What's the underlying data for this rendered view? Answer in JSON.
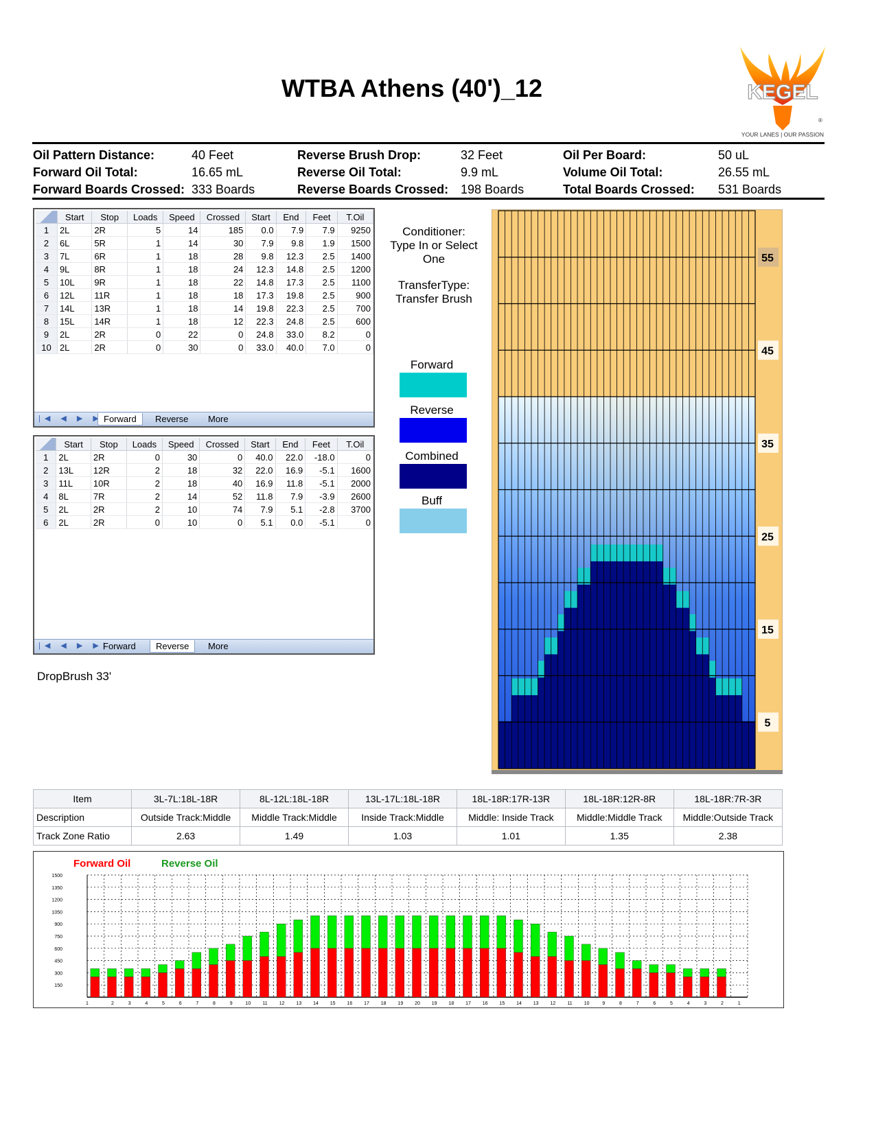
{
  "title": "WTBA Athens (40')_12",
  "logo": {
    "wordmark": "KEGEL",
    "tagline": "YOUR LANES | OUR PASSION",
    "trademark": "®"
  },
  "stats": [
    {
      "label": "Oil Pattern Distance:",
      "value": "40 Feet",
      "bold": true
    },
    {
      "label": "Forward Oil Total:",
      "value": "16.65 mL",
      "bold": false
    },
    {
      "label": "Forward Boards Crossed:",
      "value": "333 Boards",
      "bold": false
    },
    {
      "label": "Reverse Brush Drop:",
      "value": "32 Feet",
      "bold": false
    },
    {
      "label": "Reverse Oil Total:",
      "value": "9.9 mL",
      "bold": false
    },
    {
      "label": "Reverse Boards Crossed:",
      "value": "198 Boards",
      "bold": false
    },
    {
      "label": "Oil Per Board:",
      "value": "50 uL",
      "bold": true
    },
    {
      "label": "Volume Oil Total:",
      "value": "26.55 mL",
      "bold": false
    },
    {
      "label": "Total Boards Crossed:",
      "value": "531 Boards",
      "bold": false
    }
  ],
  "grid_headers": [
    "",
    "Start",
    "Stop",
    "Loads",
    "Speed",
    "Crossed",
    "Start",
    "End",
    "Feet",
    "T.Oil"
  ],
  "forward_rows": [
    [
      "1",
      "2L",
      "2R",
      "5",
      "14",
      "185",
      "0.0",
      "7.9",
      "7.9",
      "9250"
    ],
    [
      "2",
      "6L",
      "5R",
      "1",
      "14",
      "30",
      "7.9",
      "9.8",
      "1.9",
      "1500"
    ],
    [
      "3",
      "7L",
      "6R",
      "1",
      "18",
      "28",
      "9.8",
      "12.3",
      "2.5",
      "1400"
    ],
    [
      "4",
      "9L",
      "8R",
      "1",
      "18",
      "24",
      "12.3",
      "14.8",
      "2.5",
      "1200"
    ],
    [
      "5",
      "10L",
      "9R",
      "1",
      "18",
      "22",
      "14.8",
      "17.3",
      "2.5",
      "1100"
    ],
    [
      "6",
      "12L",
      "11R",
      "1",
      "18",
      "18",
      "17.3",
      "19.8",
      "2.5",
      "900"
    ],
    [
      "7",
      "14L",
      "13R",
      "1",
      "18",
      "14",
      "19.8",
      "22.3",
      "2.5",
      "700"
    ],
    [
      "8",
      "15L",
      "14R",
      "1",
      "18",
      "12",
      "22.3",
      "24.8",
      "2.5",
      "600"
    ],
    [
      "9",
      "2L",
      "2R",
      "0",
      "22",
      "0",
      "24.8",
      "33.0",
      "8.2",
      "0"
    ],
    [
      "10",
      "2L",
      "2R",
      "0",
      "30",
      "0",
      "33.0",
      "40.0",
      "7.0",
      "0"
    ]
  ],
  "reverse_rows": [
    [
      "1",
      "2L",
      "2R",
      "0",
      "30",
      "0",
      "40.0",
      "22.0",
      "-18.0",
      "0"
    ],
    [
      "2",
      "13L",
      "12R",
      "2",
      "18",
      "32",
      "22.0",
      "16.9",
      "-5.1",
      "1600"
    ],
    [
      "3",
      "11L",
      "10R",
      "2",
      "18",
      "40",
      "16.9",
      "11.8",
      "-5.1",
      "2000"
    ],
    [
      "4",
      "8L",
      "7R",
      "2",
      "14",
      "52",
      "11.8",
      "7.9",
      "-3.9",
      "2600"
    ],
    [
      "5",
      "2L",
      "2R",
      "2",
      "10",
      "74",
      "7.9",
      "5.1",
      "-2.8",
      "3700"
    ],
    [
      "6",
      "2L",
      "2R",
      "0",
      "10",
      "0",
      "5.1",
      "0.0",
      "-5.1",
      "0"
    ]
  ],
  "tabs": [
    "Forward",
    "Reverse",
    "More"
  ],
  "nav_glyphs": "|◀ ◀ ▶ ▶|",
  "drop_brush": "DropBrush 33'",
  "conditioner": [
    "Conditioner:",
    "Type In or Select",
    "One"
  ],
  "transfer": [
    "TransferType:",
    "Transfer Brush"
  ],
  "legend": [
    {
      "label": "Forward",
      "color": "#00cccc"
    },
    {
      "label": "Reverse",
      "color": "#0000ee"
    },
    {
      "label": "Combined",
      "color": "#000088"
    },
    {
      "label": "Buff",
      "color": "#87ceeb"
    }
  ],
  "colors": {
    "lane_wood": "#f9cc7a",
    "stat_green": "#1aa64b",
    "forward_oil": "#ff0000",
    "reverse_oil": "#00dd00",
    "title_red": "#ff0000"
  },
  "lane_scale": [
    "55",
    "45",
    "35",
    "25",
    "15",
    "5"
  ],
  "zone": {
    "headers": [
      "Item",
      "3L-7L:18L-18R",
      "8L-12L:18L-18R",
      "13L-17L:18L-18R",
      "18L-18R:17R-13R",
      "18L-18R:12R-8R",
      "18L-18R:7R-3R"
    ],
    "description": [
      "Description",
      "Outside Track:Middle",
      "Middle Track:Middle",
      "Inside Track:Middle",
      "Middle: Inside Track",
      "Middle:Middle Track",
      "Middle:Outside Track"
    ],
    "ratio": [
      "Track Zone Ratio",
      "2.63",
      "1.49",
      "1.03",
      "1.01",
      "1.35",
      "2.38"
    ]
  },
  "chart_data": {
    "type": "bar",
    "legend": [
      "Forward Oil",
      "Reverse Oil"
    ],
    "categories": [
      "1",
      "2",
      "3",
      "4",
      "5",
      "6",
      "7",
      "8",
      "9",
      "10",
      "11",
      "12",
      "13",
      "14",
      "15",
      "16",
      "17",
      "18",
      "19",
      "20",
      "19",
      "18",
      "17",
      "16",
      "15",
      "14",
      "13",
      "12",
      "11",
      "10",
      "9",
      "8",
      "7",
      "6",
      "5",
      "4",
      "3",
      "2",
      "1"
    ],
    "y_ticks": [
      "1500",
      "1350",
      "1200",
      "1050",
      "900",
      "750",
      "600",
      "450",
      "300",
      "150"
    ],
    "ylim": [
      0,
      1500
    ],
    "series": [
      {
        "name": "Forward Oil",
        "values": [
          0,
          250,
          250,
          250,
          250,
          300,
          350,
          350,
          400,
          450,
          450,
          500,
          500,
          550,
          600,
          600,
          600,
          600,
          600,
          600,
          600,
          600,
          600,
          600,
          600,
          600,
          550,
          500,
          500,
          450,
          450,
          400,
          350,
          350,
          300,
          300,
          250,
          250,
          250,
          0
        ]
      },
      {
        "name": "Reverse Oil",
        "values": [
          0,
          100,
          100,
          100,
          100,
          100,
          100,
          200,
          200,
          200,
          300,
          300,
          400,
          400,
          400,
          400,
          400,
          400,
          400,
          400,
          400,
          400,
          400,
          400,
          400,
          400,
          400,
          400,
          300,
          300,
          200,
          200,
          200,
          100,
          100,
          100,
          100,
          100,
          100,
          0
        ]
      }
    ]
  }
}
